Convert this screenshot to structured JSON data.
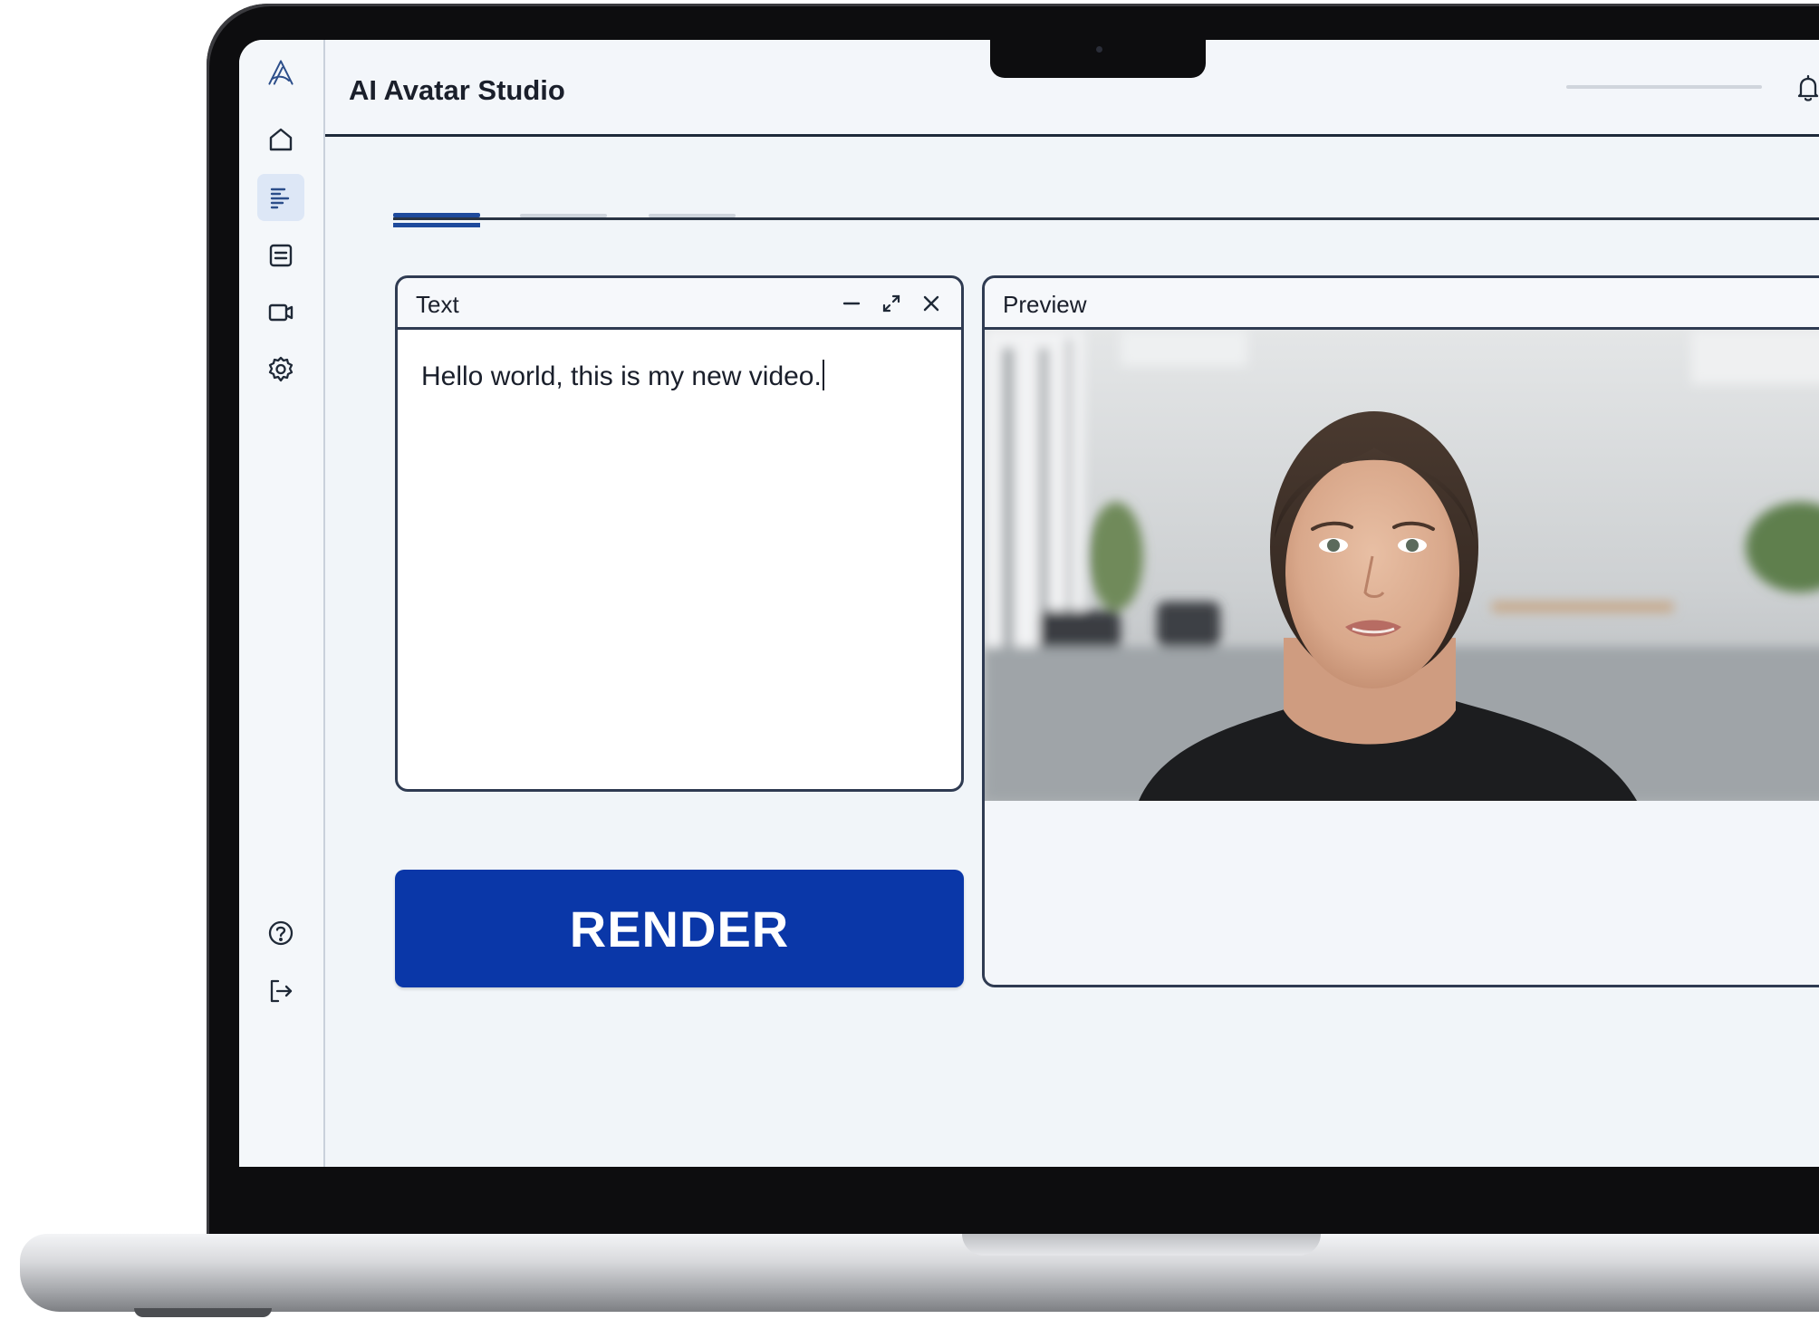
{
  "app": {
    "title": "AI Avatar Studio"
  },
  "sidebar": {
    "items": [
      {
        "name": "home",
        "icon": "home-icon"
      },
      {
        "name": "script",
        "icon": "text-lines-icon",
        "active": true
      },
      {
        "name": "document",
        "icon": "document-icon"
      },
      {
        "name": "video",
        "icon": "video-camera-icon"
      },
      {
        "name": "settings",
        "icon": "gear-icon"
      },
      {
        "name": "help",
        "icon": "help-circle-icon"
      },
      {
        "name": "logout",
        "icon": "logout-icon"
      }
    ]
  },
  "header": {
    "notifications_icon": "bell-icon"
  },
  "text_panel": {
    "title": "Text",
    "content": "Hello world, this is my new video."
  },
  "render_button": {
    "label": "RENDER"
  },
  "preview_panel": {
    "title": "Preview"
  },
  "colors": {
    "accent": "#0a37a8",
    "active_tab": "#1e4a9c",
    "panel_border": "#2f3b52"
  }
}
